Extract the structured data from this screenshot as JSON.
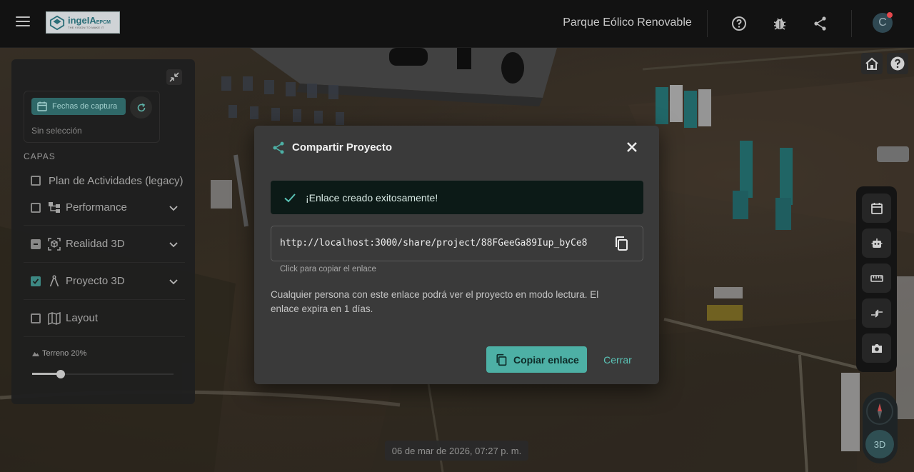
{
  "topbar": {
    "logo": {
      "main": "ingeIA",
      "suffix": "EPCM",
      "tagline": "THE VISION TO MAKE IT"
    },
    "project_name": "Parque Eólico Renovable",
    "icons": [
      "menu-icon",
      "help-circle-icon",
      "bug-icon",
      "share-icon"
    ],
    "avatar_initial": "C"
  },
  "left_panel": {
    "date_button": "Fechas de captura",
    "date_selection": "Sin selección",
    "layers_heading": "CAPAS",
    "layers": [
      {
        "label": "Plan de Actividades (legacy)",
        "state": "unchecked",
        "icon": null,
        "expandable": false
      },
      {
        "label": "Performance",
        "state": "unchecked",
        "icon": "hierarchy-icon",
        "expandable": true
      },
      {
        "label": "Realidad 3D",
        "state": "indeterminate",
        "icon": "cube-scan-icon",
        "expandable": true
      },
      {
        "label": "Proyecto 3D",
        "state": "checked",
        "icon": "compass-drafting-icon",
        "expandable": true
      },
      {
        "label": "Layout",
        "state": "unchecked",
        "icon": "map-icon",
        "expandable": false
      }
    ],
    "terrain_label": "Terreno 20%",
    "terrain_value": 0.2
  },
  "map_tools": [
    "calendar-icon",
    "robot-icon",
    "ruler-icon",
    "compare-arrows-icon",
    "camera-icon"
  ],
  "view_mode": "3D",
  "timestamp": "06 de mar de 2026, 07:27 p. m.",
  "modal": {
    "title": "Compartir Proyecto",
    "success_message": "¡Enlace creado exitosamente!",
    "share_url": "http://localhost:3000/share/project/88FGeeGa89Iup_byCe8",
    "copy_hint": "Click para copiar el enlace",
    "description": "Cualquier persona con este enlace podrá ver el proyecto en modo lectura. El enlace expira en 1 días.",
    "copy_button": "Copiar enlace",
    "close_button": "Cerrar"
  },
  "colors": {
    "accent": "#4db0a5",
    "success_bg": "#0c1a17",
    "modal_bg": "#3a3a3a",
    "topbar_bg": "#121212",
    "notification_dot": "#e5484d"
  }
}
